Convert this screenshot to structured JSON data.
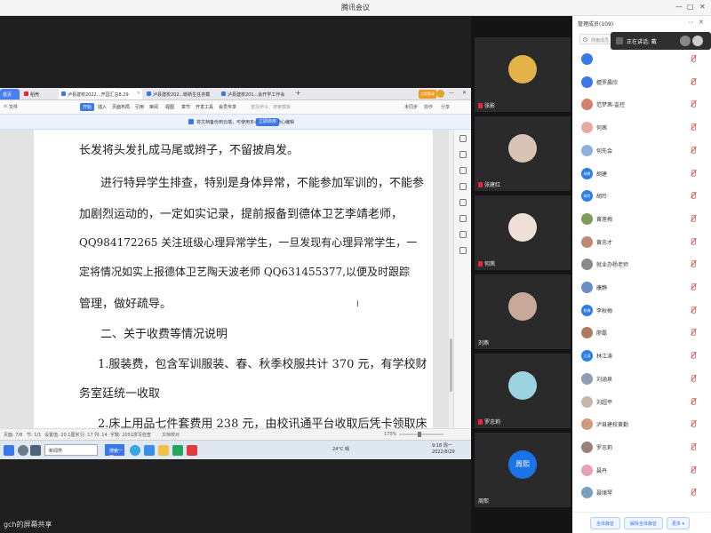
{
  "window": {
    "title": "腾讯会议"
  },
  "share": {
    "label": "gch的屏幕共享"
  },
  "wps": {
    "tabs": [
      {
        "label": "首页"
      },
      {
        "label": "稻壳"
      },
      {
        "label": "泸县建校2022...开园汇总8.29"
      },
      {
        "label": "泸县建校202...断新生任务截"
      },
      {
        "label": "泸县建校201...会开学工作会"
      }
    ],
    "login": "立即登录",
    "menu": [
      "文件",
      "开始",
      "插入",
      "页面布局",
      "引用",
      "审阅",
      "视图",
      "章节",
      "开发工具",
      "会员专享"
    ],
    "search_placeholder": "查找命令、搜索模板",
    "menu_right": [
      "未同步",
      "协作",
      "分享"
    ],
    "notice": {
      "text": "将文档备份到云端，可使用多设备同步、随心编辑",
      "button": "立即启用"
    },
    "document": {
      "lines": [
        "长发将头发扎成马尾或辫子，不留披肩发。",
        "进行特异学生排查，特别是身体异常，不能参加军训的，不能参",
        "加剧烈运动的，一定如实记录，提前报备到德体卫艺李靖老师，",
        "QQ984172265 关注班级心理异常学生，一旦发现有心理异常学生，一",
        "定将情况如实上报德体卫艺陶天波老师 QQ631455377,以便及时跟踪",
        "管理，做好疏导。",
        "二、关于收费等情况说明",
        "1.服装费，包含军训服装、春、秋季校服共计 370 元，有学校财",
        "务室廷统一收取",
        "2.床上用品七件套费用 238 元，由校讯通平台收取后凭卡领取床"
      ]
    },
    "ime": [
      "中",
      "·",
      "⌨"
    ],
    "status": {
      "page": "页面: 7/8",
      "section": "节: 1/1",
      "setting": "设置值: 20.1厘米",
      "row": "行: 17",
      "col": "列: 14",
      "words": "字数: 2051",
      "spell": "拼写检查",
      "doc_check": "文档校对",
      "zoom": "170%"
    },
    "taskbar": {
      "search": "搜索一下",
      "weather": "24°C 晴",
      "time": "9:18 周一",
      "date": "2022/8/29",
      "app1": "新闻界"
    }
  },
  "videos": [
    {
      "name": "张影",
      "color": "#e3b34a"
    },
    {
      "name": "张建红",
      "color": "#d8c3b6"
    },
    {
      "name": "何茜",
      "color": "#f0e0d8"
    },
    {
      "name": "刘燕",
      "color": "#c9a89a"
    },
    {
      "name": "罗忠莉",
      "color": "#9bd4e0"
    },
    {
      "name": "周熙",
      "color": "#1a73e8"
    }
  ],
  "video_avatar_text": "周熙",
  "panel": {
    "title": "管理成员(109)",
    "search": "搜索成员",
    "speaking": "正在讲话: 戴",
    "members": [
      {
        "name": "",
        "color": "#3b78e7",
        "text": ""
      },
      {
        "name": "檀罗晨欣",
        "color": "#3b78e7",
        "text": ""
      },
      {
        "name": "范梦茜-监控",
        "color": "#d4826b",
        "text": ""
      },
      {
        "name": "何茜",
        "color": "#e7a8a0",
        "text": ""
      },
      {
        "name": "何先会",
        "color": "#8fb0d8",
        "text": ""
      },
      {
        "name": "胡建",
        "color": "#2b7de9",
        "text": "胡建"
      },
      {
        "name": "胡玲",
        "color": "#2b7de9",
        "text": "胡玲"
      },
      {
        "name": "黄莲梅",
        "color": "#7d9b5c",
        "text": ""
      },
      {
        "name": "黄忠才",
        "color": "#c08a70",
        "text": ""
      },
      {
        "name": "就业办杨老师",
        "color": "#8a8a8a",
        "text": ""
      },
      {
        "name": "康静",
        "color": "#6a8fc7",
        "text": ""
      },
      {
        "name": "李秋梅",
        "color": "#2b7de9",
        "text": "秋梅"
      },
      {
        "name": "廖磊",
        "color": "#b07a60",
        "text": ""
      },
      {
        "name": "林江涛",
        "color": "#2b7de9",
        "text": "江涛"
      },
      {
        "name": "刘涵泉",
        "color": "#8f9db0",
        "text": ""
      },
      {
        "name": "刘超平",
        "color": "#c7b8a8",
        "text": ""
      },
      {
        "name": "泸县建校黄勤",
        "color": "#d09a80",
        "text": ""
      },
      {
        "name": "罗忠莉",
        "color": "#9a8278",
        "text": ""
      },
      {
        "name": "聂丹",
        "color": "#e6a0b8",
        "text": ""
      },
      {
        "name": "聂绪琴",
        "color": "#7aa0c0",
        "text": ""
      }
    ],
    "footer": {
      "mute_all": "全体静音",
      "unmute_all": "解除全体静音",
      "more": "更多 ▾"
    }
  }
}
